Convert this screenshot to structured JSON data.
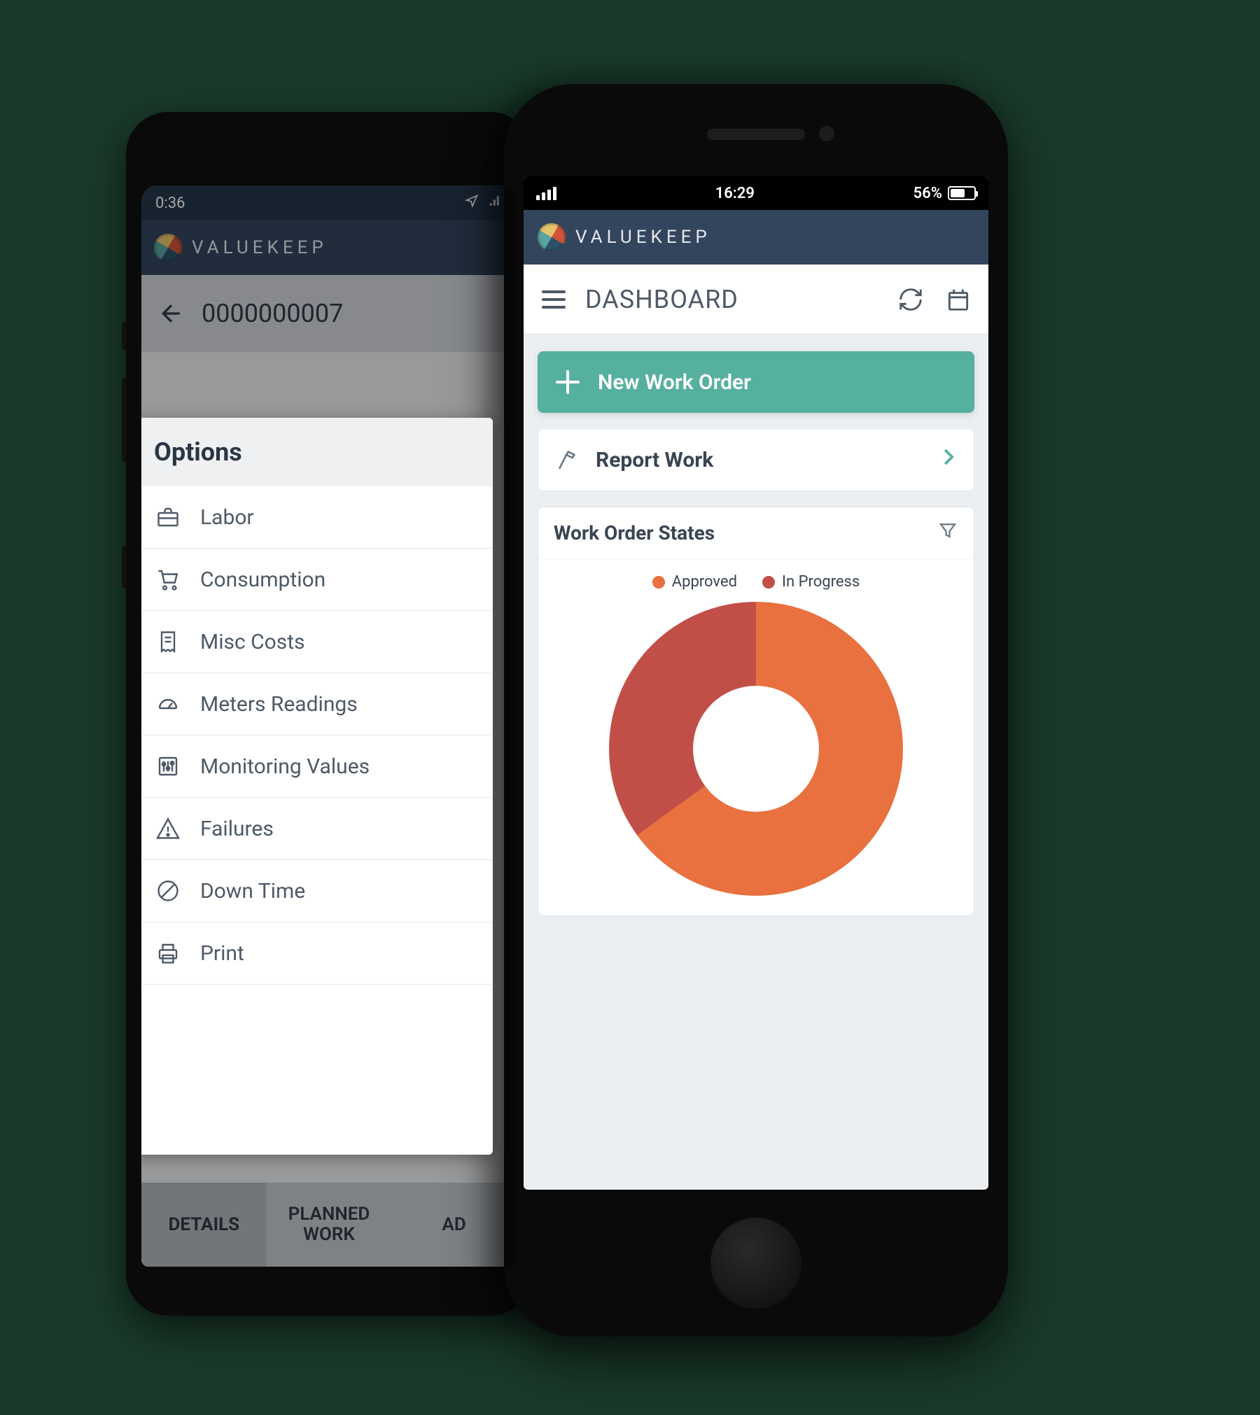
{
  "brand": {
    "name": "VALUEKEEP"
  },
  "phone_back": {
    "status": {
      "time": "0:36"
    },
    "titlebar": {
      "label": "0000000007"
    },
    "options": {
      "header": "Options",
      "items": [
        {
          "label": "Labor",
          "icon": "briefcase-icon"
        },
        {
          "label": "Consumption",
          "icon": "cart-icon"
        },
        {
          "label": "Misc Costs",
          "icon": "receipt-icon"
        },
        {
          "label": "Meters Readings",
          "icon": "gauge-icon"
        },
        {
          "label": "Monitoring Values",
          "icon": "sliders-icon"
        },
        {
          "label": "Failures",
          "icon": "warning-icon"
        },
        {
          "label": "Down Time",
          "icon": "block-icon"
        },
        {
          "label": "Print",
          "icon": "printer-icon"
        }
      ]
    },
    "tabs": [
      {
        "label": "DETAILS",
        "active": true
      },
      {
        "label": "PLANNED\nWORK",
        "active": false
      },
      {
        "label": "AD",
        "active": false
      }
    ]
  },
  "phone_front": {
    "status": {
      "time": "16:29",
      "battery_text": "56%"
    },
    "titlebar": {
      "label": "DASHBOARD"
    },
    "actions": {
      "primary_label": "New Work Order",
      "report_label": "Report Work"
    },
    "card": {
      "title": "Work Order States",
      "legend": [
        {
          "label": "Approved",
          "color": "#e8713f"
        },
        {
          "label": "In Progress",
          "color": "#c14f48"
        }
      ]
    }
  },
  "chart_data": {
    "type": "pie",
    "title": "Work Order States",
    "series": [
      {
        "name": "Approved",
        "value": 65,
        "color": "#e8713f"
      },
      {
        "name": "In Progress",
        "value": 35,
        "color": "#c14f48"
      }
    ],
    "donut": true
  }
}
